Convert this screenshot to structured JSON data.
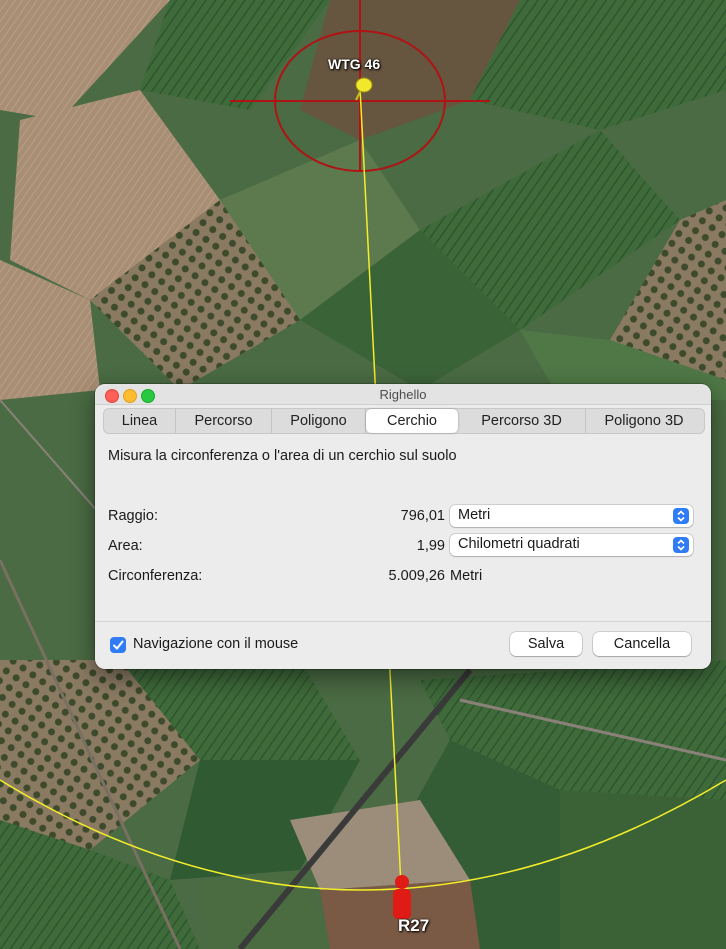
{
  "map": {
    "target_label": "WTG 46",
    "receptor_label": "R27",
    "colors": {
      "circle": "#b01313",
      "ruler_line": "#f4ee2a",
      "pin": "#f2e82b",
      "person": "#e01a14"
    }
  },
  "dialog": {
    "title": "Righello",
    "tabs": [
      {
        "label": "Linea",
        "active": false
      },
      {
        "label": "Percorso",
        "active": false
      },
      {
        "label": "Poligono",
        "active": false
      },
      {
        "label": "Cerchio",
        "active": true
      },
      {
        "label": "Percorso 3D",
        "active": false
      },
      {
        "label": "Poligono 3D",
        "active": false
      }
    ],
    "description": "Misura la circonferenza o l'area di un cerchio sul suolo",
    "rows": {
      "raggio": {
        "label": "Raggio:",
        "value": "796,01",
        "unit": "Metri"
      },
      "area": {
        "label": "Area:",
        "value": "1,99",
        "unit": "Chilometri quadrati"
      },
      "circonferenza": {
        "label": "Circonferenza:",
        "value": "5.009,26",
        "unit": "Metri"
      }
    },
    "mouse_nav": {
      "label": "Navigazione con il mouse",
      "checked": true
    },
    "buttons": {
      "save": "Salva",
      "cancel": "Cancella"
    },
    "accent": "#2f7cf6"
  }
}
